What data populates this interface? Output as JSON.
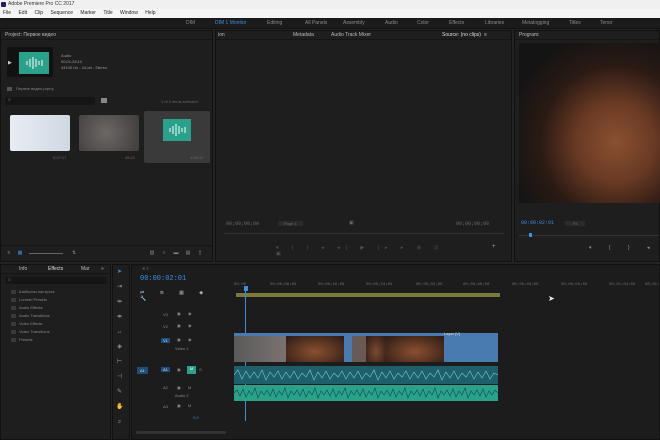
{
  "window": {
    "title": "Adobe Premiere Pro CC 2017"
  },
  "menu": [
    "File",
    "Edit",
    "Clip",
    "Sequence",
    "Marker",
    "Title",
    "Window",
    "Help"
  ],
  "workspaces": {
    "items": [
      "DIM",
      "DIM 1 Monitor",
      "Editing",
      "All Panels",
      "Assembly",
      "Audio",
      "Color",
      "Effects",
      "Libraries",
      "Metalogging",
      "Titles",
      "Tenor"
    ],
    "active_index": 1
  },
  "project": {
    "tab": "Project: Первое видео",
    "asset_name": "Audio",
    "asset_duration": "00;01;28;10",
    "asset_format": "44100 Hz - 24-bit - Stereo",
    "file_name": "Первое видео.prproj",
    "items_selected": "1 of 3 items selected",
    "clips": [
      {
        "label": "",
        "duration": "0:07:17"
      },
      {
        "label": "",
        "duration": "45:21"
      },
      {
        "label": "",
        "duration": "1:28:10"
      }
    ]
  },
  "source_monitor": {
    "tabs": [
      "ion",
      "Metadata",
      "Audio Track Mixer",
      "Source: (no clips)"
    ],
    "timecode_in": "00;00;00;00",
    "timecode_out": "00;00;00;00",
    "page": "Page 1"
  },
  "program_monitor": {
    "tab": "Program:",
    "timecode": "00:00:02:01",
    "zoom": "Fit"
  },
  "effects": {
    "tabs": [
      "Info",
      "Effects",
      "Mar"
    ],
    "items": [
      "Шаблоны настроек",
      "Lumetri Presets",
      "Audio Effects",
      "Audio Transitions",
      "Video Effects",
      "Video Transitions",
      "Presets"
    ]
  },
  "timeline": {
    "timecode": "00:00:02:01",
    "ruler": [
      "00;00",
      "00;00;08;00",
      "00;00;16;00",
      "00;00;24;00",
      "00;00;32;00",
      "00;00;40;00",
      "00;00;48;00",
      "00;00;56;00",
      "00;01;04;00",
      "00;01;"
    ],
    "tracks": [
      {
        "name": "V3",
        "label": ""
      },
      {
        "name": "V2",
        "label": ""
      },
      {
        "name": "V1",
        "label": "Video 1"
      },
      {
        "name": "A1",
        "label": ""
      },
      {
        "name": "A2",
        "label": "Audio 2"
      },
      {
        "name": "A3",
        "label": ""
      }
    ],
    "clip_label": "Layer [V]",
    "source_patch_v": "V1",
    "source_patch_a": "A1",
    "master": "0.0"
  },
  "colors": {
    "accent": "#3b8ee0",
    "audio_clip": "#2aa18a",
    "video_clip": "#4a7bb0",
    "bg": "#232323"
  }
}
